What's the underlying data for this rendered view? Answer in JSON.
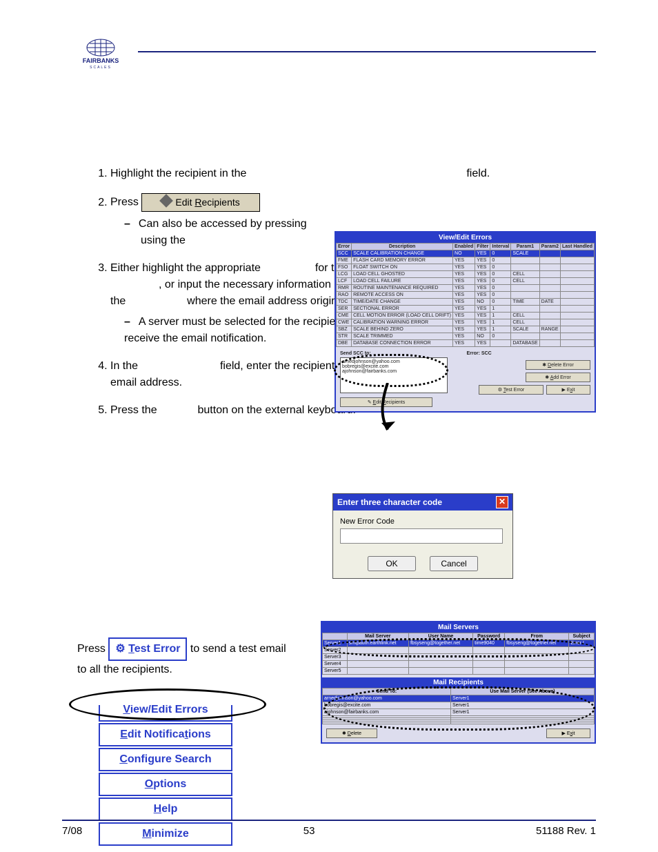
{
  "footer": {
    "left": "7/08",
    "center": "53",
    "right": "51188     Rev. 1"
  },
  "steps": {
    "s1_a": "Highlight the recipient in the",
    "s1_b": "field.",
    "s2_a": "Press",
    "s2_sub_a": "Can also be accessed by pressing",
    "s2_sub_b": "using the",
    "s3_a": "Either highlight the appropriate",
    "s3_b": "for the",
    "s3_c": ", or input the necessary information about the",
    "s3_d": "where the email address originates.",
    "s3_sub": "A server must be selected for the recipient to receive the email notification.",
    "s4_a": "In the",
    "s4_b": "field, enter the recipient's email address.",
    "s5_a": "Press the",
    "s5_b": "button on the external keyboard."
  },
  "editRecipBtn": "Edit Recipients",
  "testErrBtn": "Test Error",
  "lowtext_a": "Press",
  "lowtext_b": "to send a test email to all the recipients.",
  "vee": {
    "title": "View/Edit Errors",
    "headers": [
      "Error",
      "Description",
      "Enabled",
      "Filter",
      "Interval",
      "Param1",
      "Param2",
      "Last Handled"
    ],
    "rows": [
      [
        "SCC",
        "SCALE CALIBRATION CHANGE",
        "NO",
        "YES",
        "0",
        "SCALE",
        "",
        ""
      ],
      [
        "FME",
        "FLASH CARD MEMORY ERROR",
        "YES",
        "YES",
        "0",
        "",
        "",
        ""
      ],
      [
        "FSO",
        "FLOAT SWITCH ON",
        "YES",
        "YES",
        "0",
        "",
        "",
        ""
      ],
      [
        "LCG",
        "LOAD CELL GHOSTED",
        "YES",
        "YES",
        "0",
        "CELL",
        "",
        ""
      ],
      [
        "LCF",
        "LOAD CELL FAILURE",
        "YES",
        "YES",
        "0",
        "CELL",
        "",
        ""
      ],
      [
        "RMR",
        "ROUTINE MAINTENANCE REQUIRED",
        "YES",
        "YES",
        "0",
        "",
        "",
        ""
      ],
      [
        "RAO",
        "REMOTE ACCESS ON",
        "YES",
        "YES",
        "0",
        "",
        "",
        ""
      ],
      [
        "TDC",
        "TIME/DATE CHANGE",
        "YES",
        "NO",
        "0",
        "TIME",
        "DATE",
        ""
      ],
      [
        "SER",
        "SECTIONAL ERROR",
        "YES",
        "YES",
        "1",
        "",
        "",
        ""
      ],
      [
        "CME",
        "CELL MOTION ERROR (LOAD CELL DRIFT)",
        "YES",
        "YES",
        "1",
        "CELL",
        "",
        ""
      ],
      [
        "CWE",
        "CALIBRATION WARNING ERROR",
        "YES",
        "YES",
        "1",
        "CELL",
        "",
        ""
      ],
      [
        "SBZ",
        "SCALE BEHIND ZERO",
        "YES",
        "YES",
        "1",
        "SCALE",
        "RANGE",
        ""
      ],
      [
        "STR",
        "SCALE TRIMMED",
        "YES",
        "NO",
        "0",
        "",
        "",
        ""
      ],
      [
        "DBE",
        "DATABASE CONNECTION ERROR",
        "YES",
        "YES",
        "",
        "DATABASE",
        "",
        ""
      ]
    ],
    "sendLabel": "Send SCC to:",
    "errLabel": "Error: SCC",
    "recipients": [
      "arnedjohnson@yahoo.com",
      "bobregis@excite.com",
      "ajohnson@fairbanks.com"
    ],
    "btnDelete": "Delete Error",
    "btnAdd": "Add Error",
    "btnEdit": "Edit Recipients",
    "btnTest": "Test Error",
    "btnExit": "Exit"
  },
  "dlg": {
    "title": "Enter three character code",
    "label": "New Error Code",
    "ok": "OK",
    "cancel": "Cancel"
  },
  "ms": {
    "title1": "Mail Servers",
    "headers1": [
      "",
      "Mail Server",
      "User Name",
      "Password",
      "From",
      "Subject"
    ],
    "rows1": [
      [
        "Server1",
        "smtpauth.earthlink.net",
        "fbsyseng@together.net",
        "time9040",
        "fbsyseng@together.net",
        "Error I"
      ],
      [
        "Server2",
        "",
        "",
        "",
        "",
        ""
      ],
      [
        "Server3",
        "",
        "",
        "",
        "",
        ""
      ],
      [
        "Server4",
        "",
        "",
        "",
        "",
        ""
      ],
      [
        "Server5",
        "",
        "",
        "",
        "",
        ""
      ]
    ],
    "title2": "Mail Recipients",
    "headers2": [
      "Send To:",
      "Use Mail Server (See Above)"
    ],
    "rows2": [
      [
        "arnedjohnson@yahoo.com",
        "Server1"
      ],
      [
        "bobregis@excite.com",
        "Server1"
      ],
      [
        "ajohnson@fairbanks.com",
        "Server1"
      ],
      [
        "",
        ""
      ],
      [
        "",
        ""
      ],
      [
        "",
        ""
      ],
      [
        "",
        ""
      ]
    ],
    "btnDelete": "Delete",
    "btnExit": "Exit"
  },
  "menu": {
    "items": [
      "View/Edit Errors",
      "Edit Notifications",
      "Configure Search",
      "Options",
      "Help",
      "Minimize"
    ]
  }
}
